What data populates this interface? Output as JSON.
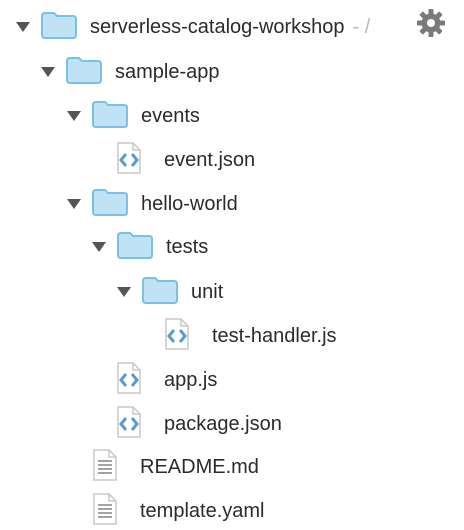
{
  "root": {
    "label": "serverless-catalog-workshop",
    "suffix": "- /",
    "settings_icon": "gear-icon"
  },
  "tree": [
    {
      "label": "sample-app",
      "kind": "folder",
      "icon": "folder-icon"
    },
    {
      "label": "events",
      "kind": "folder",
      "icon": "folder-icon"
    },
    {
      "label": "event.json",
      "kind": "code-file",
      "icon": "code-file-icon"
    },
    {
      "label": "hello-world",
      "kind": "folder",
      "icon": "folder-icon"
    },
    {
      "label": "tests",
      "kind": "folder",
      "icon": "folder-icon"
    },
    {
      "label": "unit",
      "kind": "folder",
      "icon": "folder-icon"
    },
    {
      "label": "test-handler.js",
      "kind": "code-file",
      "icon": "code-file-icon"
    },
    {
      "label": "app.js",
      "kind": "code-file",
      "icon": "code-file-icon"
    },
    {
      "label": "package.json",
      "kind": "code-file",
      "icon": "code-file-icon"
    },
    {
      "label": "README.md",
      "kind": "text-file",
      "icon": "text-file-icon"
    },
    {
      "label": "template.yaml",
      "kind": "text-file",
      "icon": "text-file-icon"
    }
  ],
  "colors": {
    "folder_fill": "#bfe3f5",
    "folder_stroke": "#7cc0e6",
    "code_bracket": "#5b9bd5",
    "text_lines": "#8a8a8a",
    "toggle": "#555555",
    "gear": "#7a7a7a",
    "label": "#2b2b2b",
    "suffix": "#b7b7b7"
  }
}
